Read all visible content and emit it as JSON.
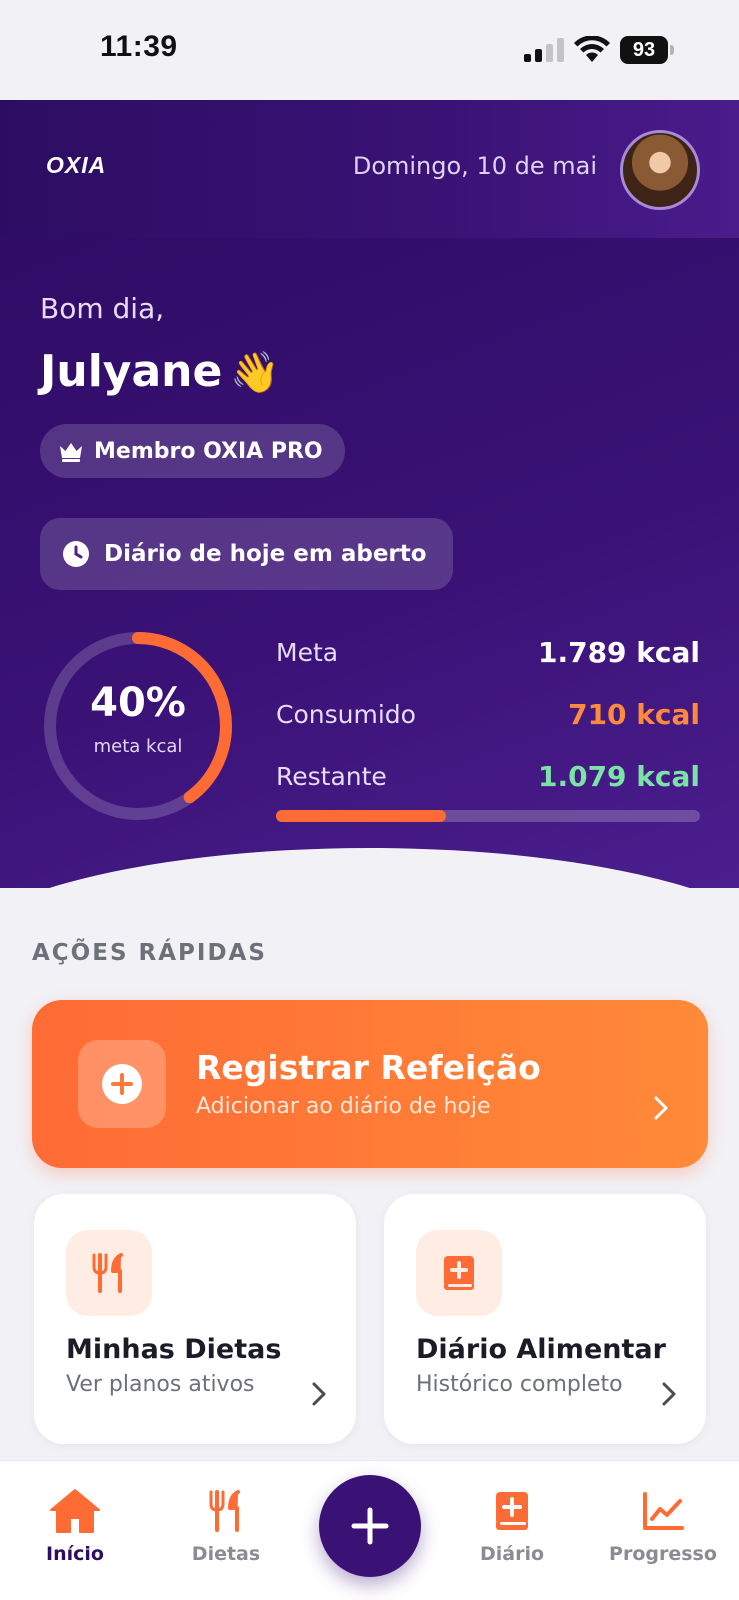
{
  "status_bar": {
    "time": "11:39",
    "battery": "93"
  },
  "header": {
    "logo": "OXIA",
    "date": "Domingo, 10 de mai"
  },
  "hero": {
    "greeting": "Bom dia,",
    "name": "Julyane",
    "wave_emoji": "👋",
    "membership_badge": "Membro OXIA PRO",
    "diary_status": "Diário de hoje em aberto",
    "ring": {
      "percent_text": "40%",
      "label": "meta kcal",
      "fraction": 0.4
    },
    "stats": [
      {
        "label": "Meta",
        "value": "1.789 kcal",
        "color": "#ffffff"
      },
      {
        "label": "Consumido",
        "value": "710 kcal",
        "color": "#ff8a3d"
      },
      {
        "label": "Restante",
        "value": "1.079 kcal",
        "color": "#7be3a8"
      }
    ],
    "progress_fraction": 0.4
  },
  "quick_actions": {
    "section_title": "AÇÕES RÁPIDAS",
    "primary": {
      "title": "Registrar Refeição",
      "subtitle": "Adicionar ao diário de hoje",
      "icon": "plus-circle-icon"
    },
    "cards": [
      {
        "title": "Minhas Dietas",
        "subtitle": "Ver planos ativos",
        "icon": "fork-knife-icon"
      },
      {
        "title": "Diário Alimentar",
        "subtitle": "Histórico completo",
        "icon": "medical-book-icon"
      }
    ]
  },
  "bottom_nav": {
    "items": [
      {
        "label": "Início",
        "icon": "home-icon",
        "active": true
      },
      {
        "label": "Dietas",
        "icon": "fork-knife-icon",
        "active": false
      },
      {
        "label": "Diário",
        "icon": "medical-book-icon",
        "active": false
      },
      {
        "label": "Progresso",
        "icon": "chart-line-icon",
        "active": false
      }
    ],
    "fab_icon": "plus-icon"
  },
  "colors": {
    "brand_purple": "#3a1276",
    "accent_orange": "#ff6b35",
    "success_green": "#7be3a8"
  }
}
